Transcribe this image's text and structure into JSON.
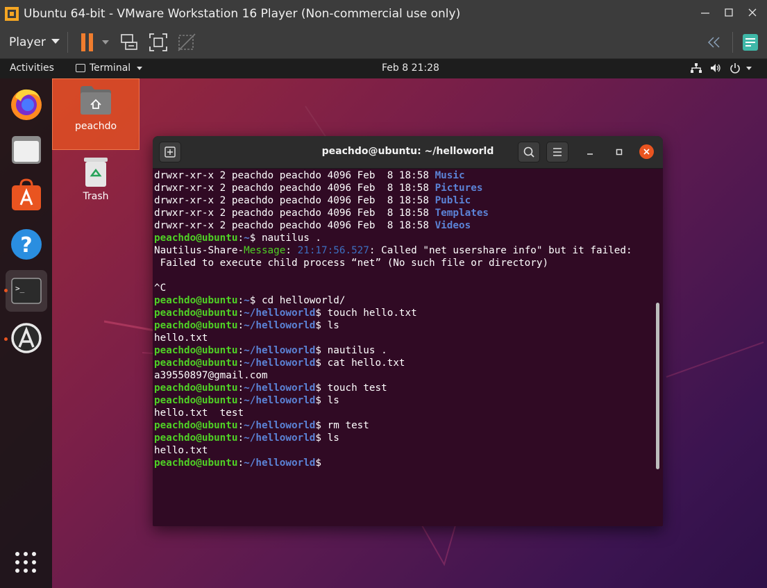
{
  "vmware": {
    "window_title": "Ubuntu 64-bit - VMware Workstation 16 Player (Non-commercial use only)",
    "player_menu": "Player",
    "controls": {
      "minimize": "—",
      "maximize": "☐",
      "close": "✕"
    }
  },
  "ubuntu_topbar": {
    "activities": "Activities",
    "app_menu": "Terminal",
    "clock": "Feb 8  21:28"
  },
  "dock": {
    "items": [
      "firefox",
      "files",
      "software-center",
      "help",
      "terminal",
      "software-updater"
    ],
    "active": "terminal"
  },
  "desktop_icons": {
    "home_label": "peachdo",
    "trash_label": "Trash"
  },
  "terminal": {
    "title": "peachdo@ubuntu: ~/helloworld",
    "lines": [
      {
        "t": "ls",
        "text": "drwxr-xr-x 2 peachdo peachdo 4096 Feb  8 18:58 ",
        "name": "Music"
      },
      {
        "t": "ls",
        "text": "drwxr-xr-x 2 peachdo peachdo 4096 Feb  8 18:58 ",
        "name": "Pictures"
      },
      {
        "t": "ls",
        "text": "drwxr-xr-x 2 peachdo peachdo 4096 Feb  8 18:58 ",
        "name": "Public"
      },
      {
        "t": "ls",
        "text": "drwxr-xr-x 2 peachdo peachdo 4096 Feb  8 18:58 ",
        "name": "Templates"
      },
      {
        "t": "ls",
        "text": "drwxr-xr-x 2 peachdo peachdo 4096 Feb  8 18:58 ",
        "name": "Videos"
      },
      {
        "t": "prompt",
        "user": "peachdo@ubuntu",
        "path": "~",
        "cmd": " nautilus ."
      },
      {
        "t": "msg",
        "a": "Nautilus-Share-",
        "b": "Message",
        "c": ": ",
        "ts": "21:17:56.527",
        "d": ": Called \"net usershare info\" but it failed:"
      },
      {
        "t": "out",
        "text": " Failed to execute child process “net” (No such file or directory)"
      },
      {
        "t": "out",
        "text": ""
      },
      {
        "t": "out",
        "text": "^C"
      },
      {
        "t": "prompt",
        "user": "peachdo@ubuntu",
        "path": "~",
        "cmd": " cd helloworld/"
      },
      {
        "t": "prompt",
        "user": "peachdo@ubuntu",
        "path": "~/helloworld",
        "cmd": " touch hello.txt"
      },
      {
        "t": "prompt",
        "user": "peachdo@ubuntu",
        "path": "~/helloworld",
        "cmd": " ls"
      },
      {
        "t": "out",
        "text": "hello.txt"
      },
      {
        "t": "prompt",
        "user": "peachdo@ubuntu",
        "path": "~/helloworld",
        "cmd": " nautilus ."
      },
      {
        "t": "prompt",
        "user": "peachdo@ubuntu",
        "path": "~/helloworld",
        "cmd": " cat hello.txt"
      },
      {
        "t": "out",
        "text": "a39550897@gmail.com"
      },
      {
        "t": "prompt",
        "user": "peachdo@ubuntu",
        "path": "~/helloworld",
        "cmd": " touch test"
      },
      {
        "t": "prompt",
        "user": "peachdo@ubuntu",
        "path": "~/helloworld",
        "cmd": " ls"
      },
      {
        "t": "out",
        "text": "hello.txt  test"
      },
      {
        "t": "prompt",
        "user": "peachdo@ubuntu",
        "path": "~/helloworld",
        "cmd": " rm test"
      },
      {
        "t": "prompt",
        "user": "peachdo@ubuntu",
        "path": "~/helloworld",
        "cmd": " ls"
      },
      {
        "t": "out",
        "text": "hello.txt"
      },
      {
        "t": "prompt",
        "user": "peachdo@ubuntu",
        "path": "~/helloworld",
        "cmd": ""
      }
    ]
  },
  "colors": {
    "accent": "#e95420",
    "terminal_bg": "#300a24",
    "prompt_user": "#4fd125",
    "prompt_path": "#5b83d6",
    "vmware_pause": "#f07d2e"
  }
}
